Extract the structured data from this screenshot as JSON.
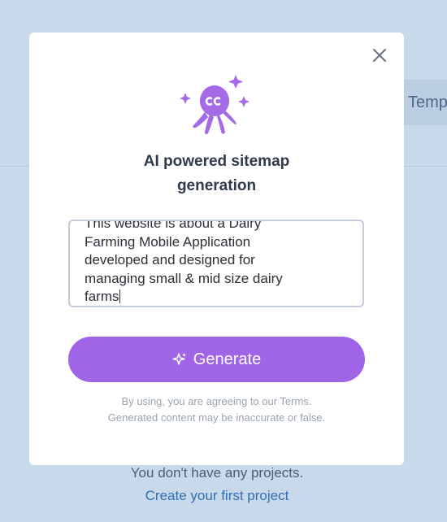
{
  "background": {
    "tab_label": "Temp",
    "empty_message": "You don't have any projects.",
    "create_link": "Create your first project"
  },
  "modal": {
    "close_icon": "close-icon",
    "mascot_icon": "octopus-sparkles-icon",
    "title_line1": "AI powered sitemap",
    "title_line2": "generation",
    "prompt_value": "This website is about a Dairy Farming Mobile Application developed and designed for managing small & mid size dairy farms",
    "prompt_lines": [
      "This website is about a Dairy",
      "Farming Mobile Application",
      "developed and designed for",
      "managing small & mid size dairy",
      "farms"
    ],
    "generate_icon": "sparkle-icon",
    "generate_label": "Generate",
    "disclaimer_line1": "By using, you are agreeing to our Terms.",
    "disclaimer_line2": "Generated content may be inaccurate or false."
  },
  "colors": {
    "page_background": "#c9d9ec",
    "accent_purple": "#a065e6",
    "link_blue": "#2f6fb2"
  }
}
